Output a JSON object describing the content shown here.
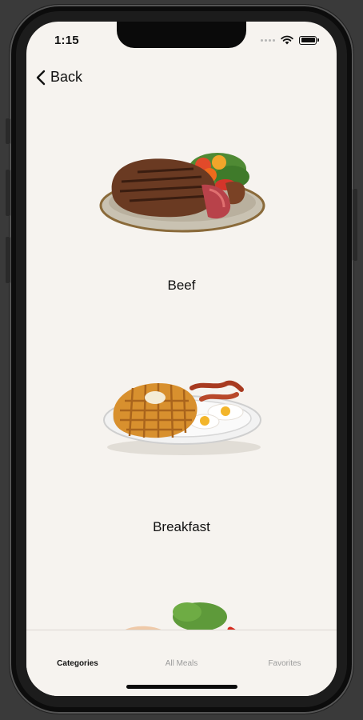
{
  "status_bar": {
    "time": "1:15"
  },
  "nav": {
    "back_label": "Back"
  },
  "categories": [
    {
      "label": "Beef",
      "image": "beef-steak-plate"
    },
    {
      "label": "Breakfast",
      "image": "waffle-breakfast-plate"
    },
    {
      "label": "",
      "image": "chicken-plate"
    }
  ],
  "tabbar": {
    "items": [
      {
        "label": "Categories",
        "active": true
      },
      {
        "label": "All Meals",
        "active": false
      },
      {
        "label": "Favorites",
        "active": false
      }
    ]
  }
}
